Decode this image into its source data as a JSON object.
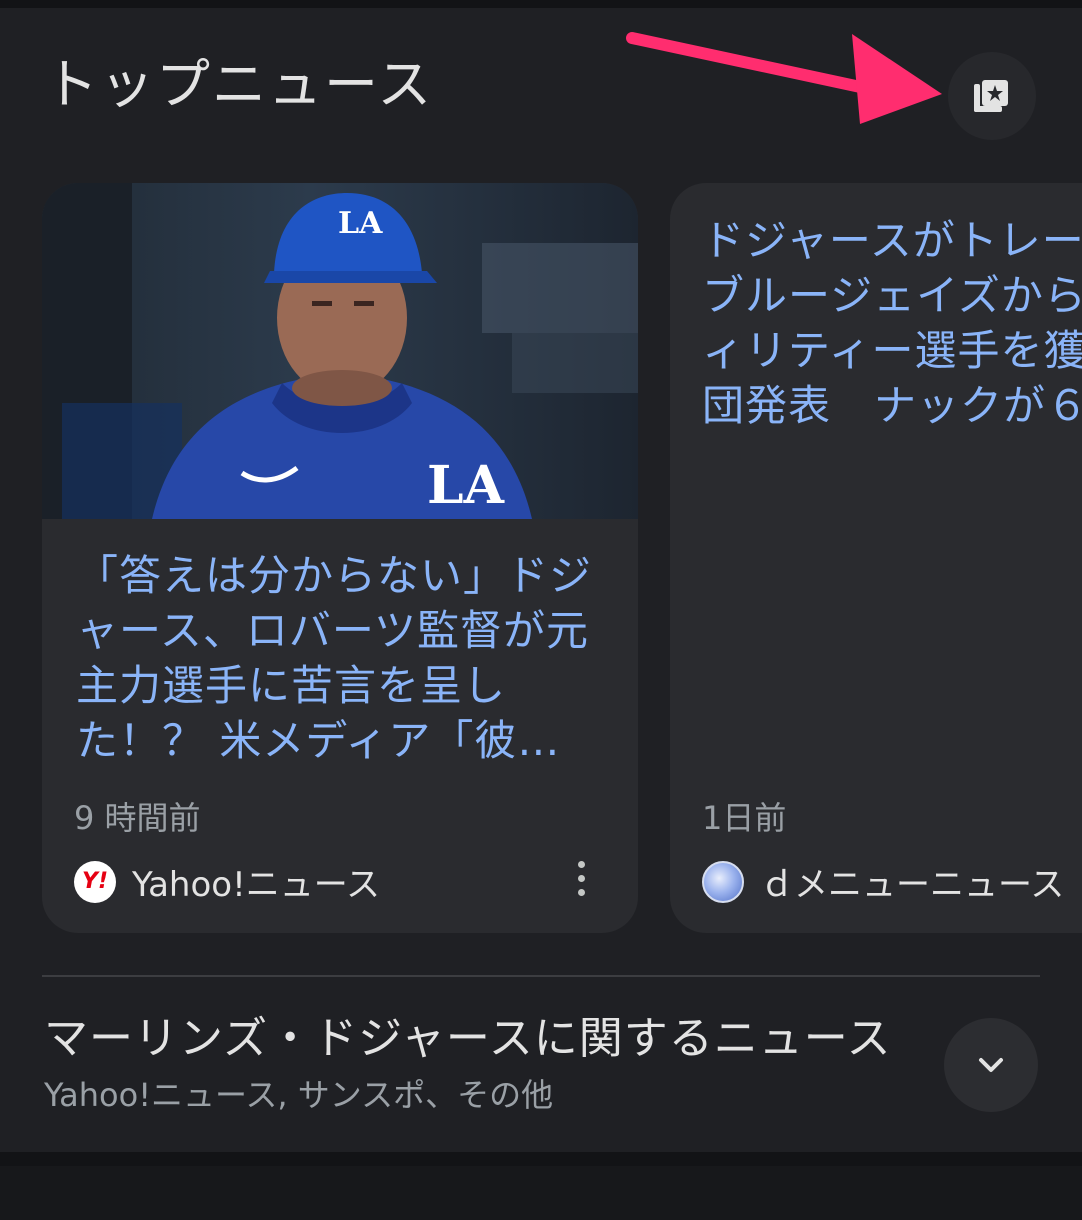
{
  "section": {
    "title": "トップニュース",
    "save_icon": "library-add-star-icon"
  },
  "cards": [
    {
      "headline": "「答えは分からない」ドジャース、ロバーツ監督が元主力選手に苦言を呈した！？ 米メディア「彼…",
      "time": "9 時間前",
      "source_name": "Yahoo!ニュース",
      "source_logo_text": "Y!",
      "image": "dodgers-manager-photo"
    },
    {
      "headline": "ドジャースがトレー\nブルージェイズから\nィリティー選手を獲\n団発表　ナックが６",
      "time": "1日前",
      "source_name": "ｄメニューニュース"
    }
  ],
  "topic": {
    "title": "マーリンズ・ドジャースに関するニュース",
    "sources": "Yahoo!ニュース, サンスポ、その他"
  },
  "colors": {
    "background": "#1f2024",
    "card": "#2a2b2f",
    "headline_link": "#8ab4f8",
    "annotation_arrow": "#ff2d6f"
  }
}
